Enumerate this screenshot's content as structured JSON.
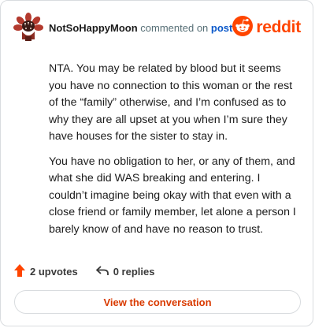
{
  "comment": {
    "username": "NotSoHappyMoon",
    "action_text": "commented on",
    "target_link": "post",
    "paragraphs": [
      "NTA. You may be related by blood but it seems you have no connection to this woman or the rest of the “family” otherwise, and I’m confused as to why they are all upset at you when I’m sure they have houses for the sister to stay in.",
      "You have no obligation to her, or any of them, and what she did WAS breaking and entering. I couldn’t imagine being okay with that even with a close friend or family member, let alone a person I barely know of and have no reason to trust."
    ]
  },
  "brand": {
    "wordmark": "reddit",
    "color": "#ff4500"
  },
  "actions": {
    "upvotes_label": "2 upvotes",
    "replies_label": "0 replies",
    "upvote_color": "#ff4500"
  },
  "cta": {
    "label": "View the conversation",
    "color": "#d93a00"
  },
  "icons": {
    "avatar": "demogorgon-avatar-icon",
    "brand": "reddit-snoo-icon",
    "upvote": "upvote-arrow-icon",
    "reply": "reply-arrow-icon"
  }
}
